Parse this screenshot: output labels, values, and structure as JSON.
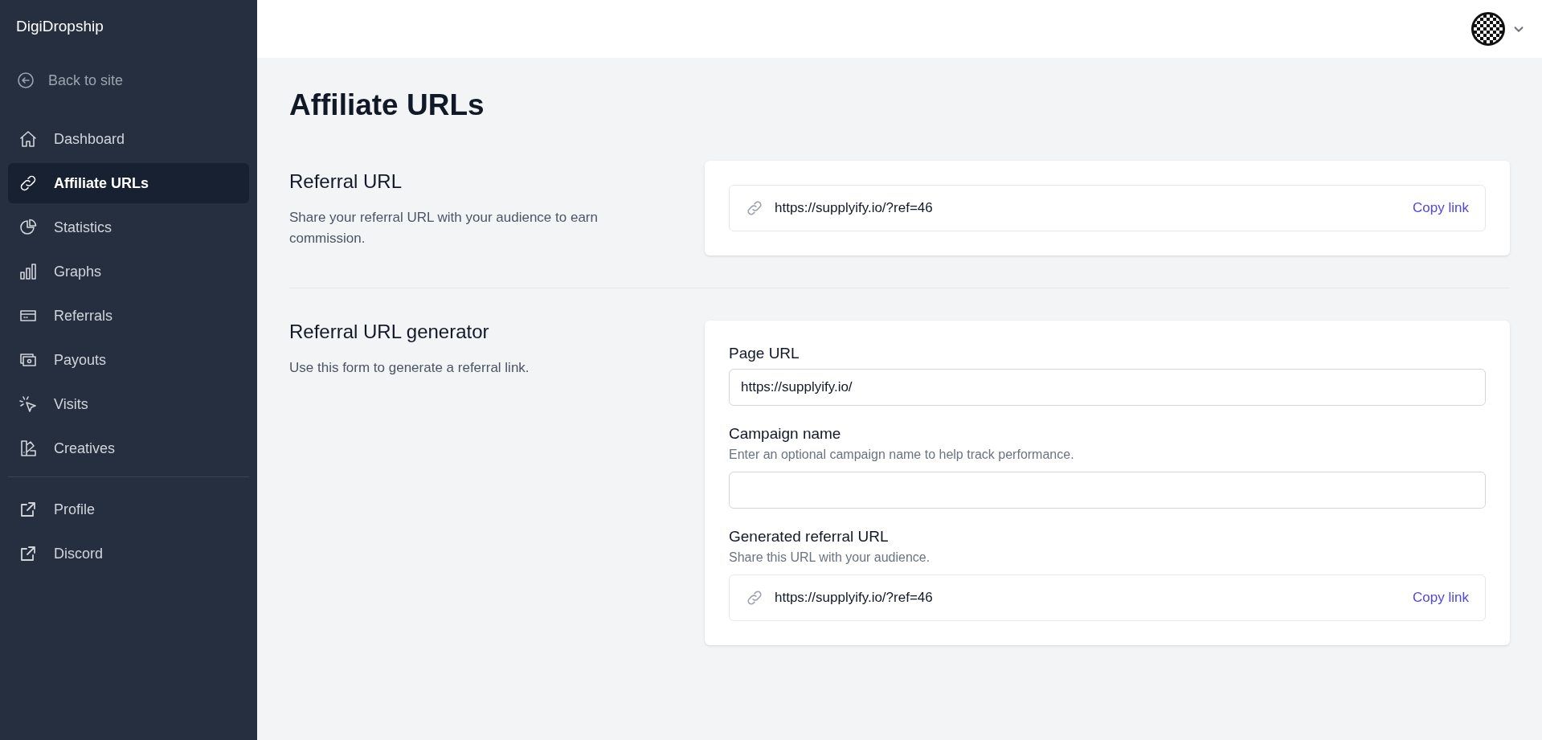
{
  "sidebar": {
    "brand": "DigiDropship",
    "back_link": "Back to site",
    "items": [
      {
        "label": "Dashboard",
        "selected": false
      },
      {
        "label": "Affiliate URLs",
        "selected": true
      },
      {
        "label": "Statistics",
        "selected": false
      },
      {
        "label": "Graphs",
        "selected": false
      },
      {
        "label": "Referrals",
        "selected": false
      },
      {
        "label": "Payouts",
        "selected": false
      },
      {
        "label": "Visits",
        "selected": false
      },
      {
        "label": "Creatives",
        "selected": false
      }
    ],
    "external_links": [
      {
        "label": "Profile"
      },
      {
        "label": "Discord"
      }
    ]
  },
  "page_title": "Affiliate URLs",
  "referral_url": {
    "title": "Referral URL",
    "description": "Share your referral URL with your audience to earn commission.",
    "url": "https://supplyify.io/?ref=46",
    "copy_label": "Copy link"
  },
  "generator": {
    "title": "Referral URL generator",
    "description": "Use this form to generate a referral link.",
    "page_url": {
      "label": "Page URL",
      "value": "https://supplyify.io/"
    },
    "campaign": {
      "label": "Campaign name",
      "hint": "Enter an optional campaign name to help track performance."
    },
    "generated": {
      "label": "Generated referral URL",
      "hint": "Share this URL with your audience.",
      "url": "https://supplyify.io/?ref=46",
      "copy_label": "Copy link"
    }
  }
}
